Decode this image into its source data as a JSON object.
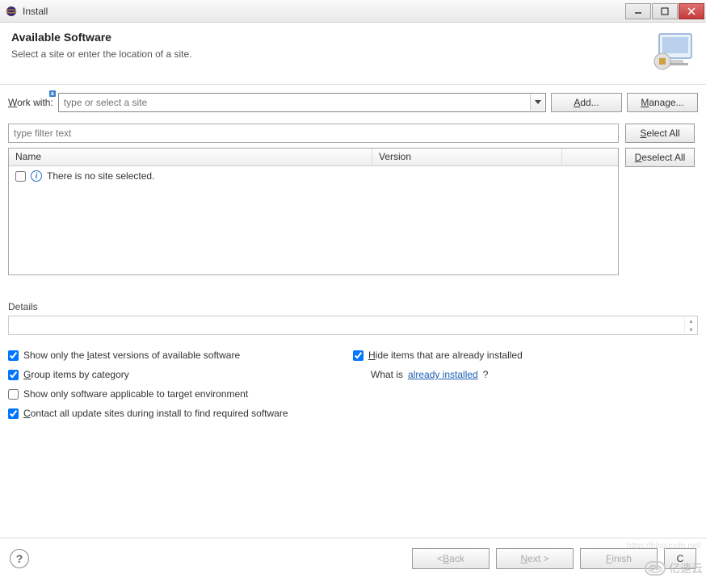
{
  "window": {
    "title": "Install"
  },
  "banner": {
    "title": "Available Software",
    "description": "Select a site or enter the location of a site."
  },
  "workwith": {
    "label_pre": "W",
    "label_post": "ork with:",
    "placeholder": "type or select a site"
  },
  "buttons": {
    "add": "Add...",
    "manage": "Manage...",
    "select_all": "Select All",
    "deselect_all": "Deselect All",
    "back": "Back",
    "next": "Next >",
    "finish": "Finish",
    "cancel": "Cancel"
  },
  "filter": {
    "placeholder": "type filter text"
  },
  "table": {
    "columns": {
      "name": "Name",
      "version": "Version"
    },
    "rows": [
      {
        "text": "There is no site selected."
      }
    ]
  },
  "details": {
    "label": "Details"
  },
  "options": {
    "latest_versions": {
      "checked": true,
      "label_pre": "Show only the ",
      "mnemonic": "l",
      "label_post": "atest versions of available software"
    },
    "hide_installed": {
      "checked": true,
      "label_pre": "",
      "mnemonic": "H",
      "label_post": "ide items that are already installed"
    },
    "group_by_category": {
      "checked": true,
      "label_pre": "",
      "mnemonic": "G",
      "label_post": "roup items by category"
    },
    "what_is": {
      "prefix": "What is ",
      "link": "already installed",
      "suffix": "?"
    },
    "target_env": {
      "checked": false,
      "label": "Show only software applicable to target environment"
    },
    "contact_sites": {
      "checked": true,
      "label_pre": "",
      "mnemonic": "C",
      "label_post": "ontact all update sites during install to find required software"
    }
  },
  "watermark": {
    "text": "亿速云",
    "subtext": "https://blog.csdn.net/"
  }
}
